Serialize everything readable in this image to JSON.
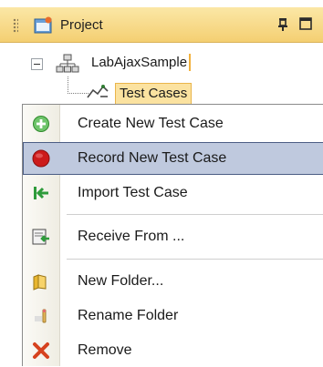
{
  "panel": {
    "title": "Project",
    "icons": {
      "title": "project-window-icon",
      "pin": "pin-icon",
      "maximize": "maximize-icon"
    }
  },
  "tree": {
    "project": {
      "label": "LabAjaxSample",
      "icon": "project-icon",
      "expanded": true
    },
    "node": {
      "label": "Test Cases",
      "icon": "test-cases-icon",
      "selected": true
    }
  },
  "context_menu": {
    "items": [
      {
        "label": "Create New Test Case",
        "icon": "add-green-icon"
      },
      {
        "label": "Record New Test Case",
        "icon": "record-red-icon",
        "highlighted": true
      },
      {
        "label": "Import Test Case",
        "icon": "import-arrow-icon"
      },
      {
        "label": "Receive From ...",
        "icon": "receive-icon"
      },
      {
        "label": "New Folder...",
        "icon": "folder-icon"
      },
      {
        "label": "Rename Folder",
        "icon": "rename-icon"
      },
      {
        "label": "Remove",
        "icon": "remove-x-icon"
      }
    ]
  },
  "colors": {
    "titlebar": "#f4cf72",
    "highlight_bg": "#bfc9de",
    "highlight_border": "#4b5d84",
    "selection_bg": "#fbe2a0"
  }
}
